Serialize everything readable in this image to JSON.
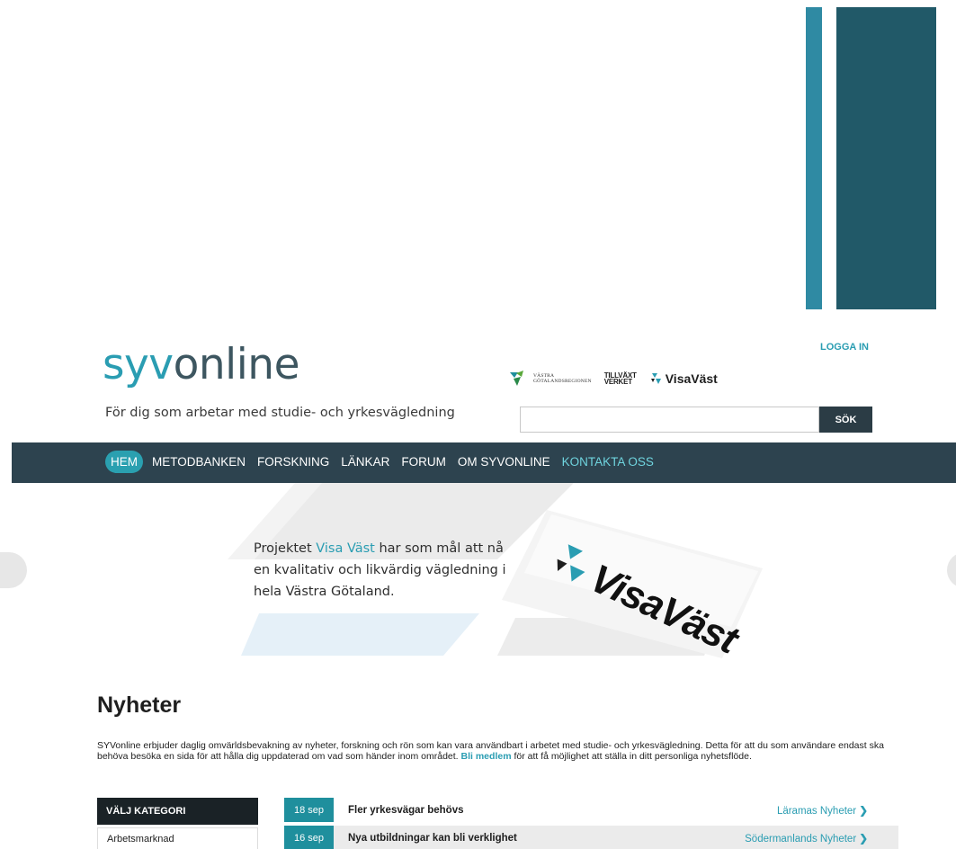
{
  "header": {
    "login": "LOGGA IN",
    "logo_part1": "syv",
    "logo_part2": "online",
    "tagline": "För dig som arbetar med studie- och yrkesvägledning",
    "partners": {
      "vgr_line1": "VÄSTRA",
      "vgr_line2": "GÖTALANDSREGIONEN",
      "tillvaxt_line1": "TILLVÄXT",
      "tillvaxt_line2": "VERKET",
      "visa_vast": "VisaVäst"
    },
    "search": {
      "placeholder": "",
      "button": "SÖK"
    }
  },
  "nav": {
    "items": [
      {
        "label": "HEM"
      },
      {
        "label": "METODBANKEN"
      },
      {
        "label": "FORSKNING"
      },
      {
        "label": "LÄNKAR"
      },
      {
        "label": "FORUM"
      },
      {
        "label": "OM SYVONLINE"
      },
      {
        "label": "KONTAKTA OSS"
      }
    ]
  },
  "hero": {
    "text_before": "Projektet ",
    "highlight": "Visa Väst",
    "text_after": " har som mål att nå",
    "line2": "en kvalitativ och likvärdig vägledning i",
    "line3": "hela Västra Götaland.",
    "card_logo": "VisaVäst"
  },
  "news": {
    "title": "Nyheter",
    "intro_before": "SYVonline erbjuder daglig omvärldsbevakning av nyheter, forskning och rön som kan vara användbart i arbetet med studie- och yrkesvägledning. Detta för att du som användare endast ska behöva besöka en sida för att hålla dig uppdaterad om vad som händer inom området. ",
    "intro_link": "Bli medlem",
    "intro_after": " för att få möjlighet att ställa in ditt personliga nyhetsflöde.",
    "category_header": "VÄLJ KATEGORI",
    "categories": [
      "Arbetsmarknad"
    ],
    "items": [
      {
        "date": "18 sep",
        "headline": "Fler yrkesvägar behövs",
        "source": "Läramas Nyheter"
      },
      {
        "date": "16 sep",
        "headline": "Nya utbildningar kan bli verklighet",
        "source": "Södermanlands Nyheter"
      }
    ]
  },
  "colors": {
    "accent": "#2a9db2",
    "nav_bg": "#2d434f",
    "date_badge": "#1f8f9d",
    "deco_bar_light": "#2f8aa3",
    "deco_bar_dark": "#215968"
  }
}
